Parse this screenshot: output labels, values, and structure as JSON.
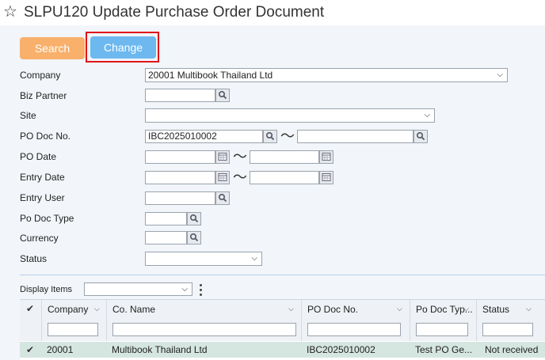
{
  "title": "SLPU120 Update Purchase Order Document",
  "buttons": {
    "search": "Search",
    "change": "Change"
  },
  "form": {
    "company_label": "Company",
    "company_value": "20001 Multibook Thailand Ltd",
    "biz_partner_label": "Biz Partner",
    "site_label": "Site",
    "po_doc_no_label": "PO Doc No.",
    "po_doc_no_from": "IBC2025010002",
    "po_date_label": "PO Date",
    "entry_date_label": "Entry Date",
    "entry_user_label": "Entry User",
    "po_doc_type_label": "Po Doc Type",
    "currency_label": "Currency",
    "status_label": "Status",
    "range_sep": "〜"
  },
  "display_items_label": "Display Items",
  "grid": {
    "columns": [
      "Company",
      "Co. Name",
      "PO Doc No.",
      "Po Doc Typ...",
      "Status"
    ],
    "rows": [
      {
        "company": "20001",
        "co_name": "Multibook Thailand Ltd",
        "po_doc_no": "IBC2025010002",
        "po_doc_type": "Test PO Ge...",
        "status": "Not received"
      }
    ]
  },
  "colors": {
    "search_button": "#f8b06b",
    "change_button": "#6db8ef",
    "highlight": "#e0141a",
    "row_bg": "#d5e6e0"
  },
  "icons": [
    "star-icon",
    "magnifier-icon",
    "calendar-icon",
    "chevron-down-icon",
    "checkmark-icon",
    "kebab-menu-icon"
  ]
}
